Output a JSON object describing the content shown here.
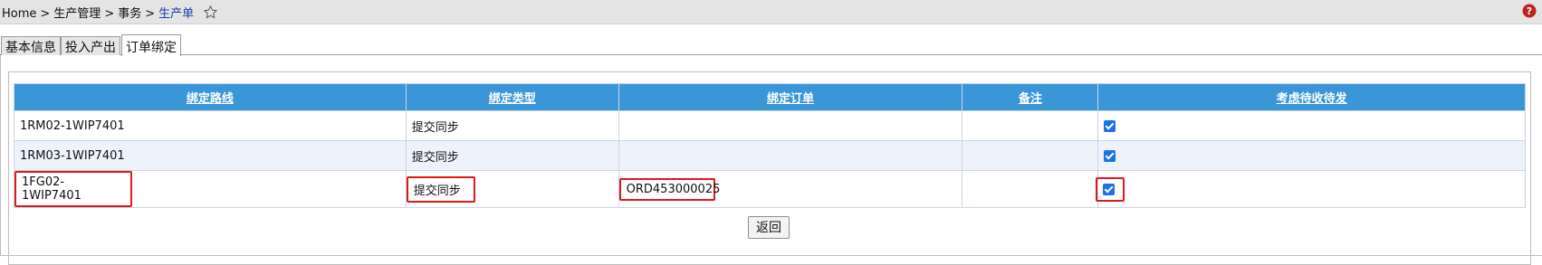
{
  "breadcrumb": {
    "home": "Home",
    "separator": ">",
    "level1": "生产管理",
    "level2": "事务",
    "current": "生产单"
  },
  "icons": {
    "favorite": "star-outline-icon",
    "help": "help-icon",
    "help_color": "#c0201f"
  },
  "tabs": [
    {
      "label": "基本信息",
      "active": false
    },
    {
      "label": "投入产出",
      "active": false
    },
    {
      "label": "订单绑定",
      "active": true
    }
  ],
  "table": {
    "header_color": "#3a96d6",
    "columns": [
      "绑定路线",
      "绑定类型",
      "绑定订单",
      "备注",
      "考虑待收待发"
    ],
    "rows": [
      {
        "route": "1RM02-1WIP7401",
        "type": "提交同步",
        "order": "",
        "remark": "",
        "consider": true
      },
      {
        "route": "1RM03-1WIP7401",
        "type": "提交同步",
        "order": "",
        "remark": "",
        "consider": true
      },
      {
        "route": "1FG02-1WIP7401",
        "type": "提交同步",
        "order": "ORD453000025",
        "remark": "",
        "consider": true
      }
    ]
  },
  "highlight_color": "#e01818",
  "buttons": {
    "back": "返回"
  }
}
